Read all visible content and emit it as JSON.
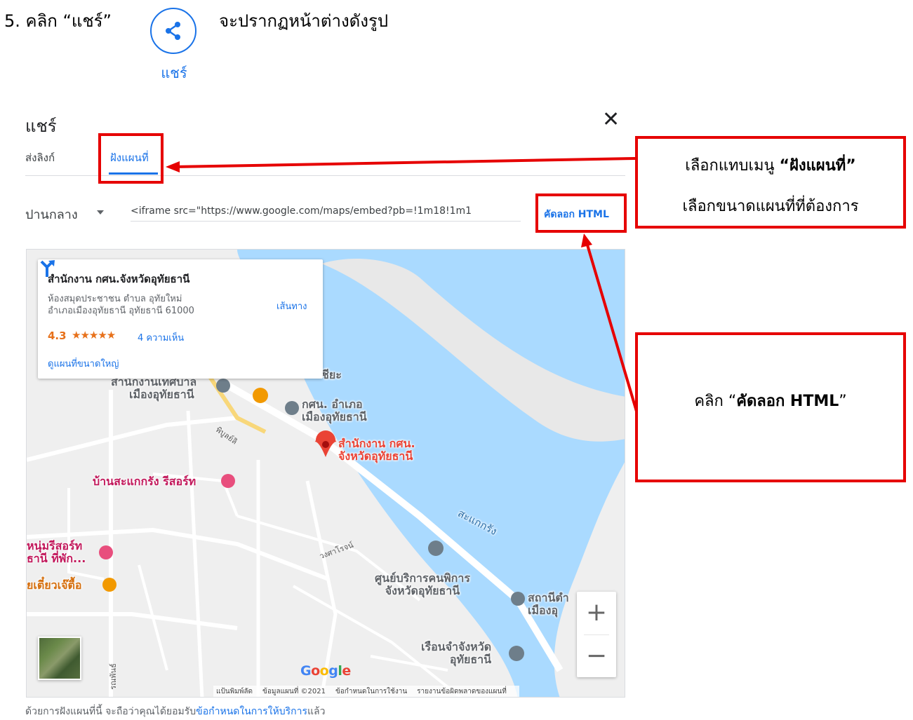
{
  "instruction": {
    "step": "5. คลิก “แชร์”",
    "after": "จะปรากฏหน้าต่างดังรูป",
    "share_button_label": "แชร์"
  },
  "dialog": {
    "title": "แชร์",
    "close_glyph": "✕",
    "tabs": [
      "ส่งลิงก์",
      "ฝังแผนที่"
    ],
    "size_select": "ปานกลาง",
    "iframe_code": "<iframe src=\"https://www.google.com/maps/embed?pb=!1m18!1m1",
    "copy_button": "คัดลอก HTML",
    "terms_prefix": "ด้วยการฝังแผนที่นี้ จะถือว่าคุณได้ยอมรับ",
    "terms_link": "ข้อกำหนดในการให้บริการ",
    "terms_suffix": "แล้ว"
  },
  "map": {
    "info_card": {
      "title": "สำนักงาน กศน.จังหวัดอุทัยธานี",
      "address_line1": "ห้องสมุดประชาชน ตำบล อุทัยใหม่",
      "address_line2": "อำเภอเมืองอุทัยธานี อุทัยธานี 61000",
      "rating": "4.3",
      "stars": "★★★★★",
      "reviews": "4 ความเห็น",
      "view_larger": "ดูแผนที่ขนาดใหญ่",
      "directions": "เส้นทาง"
    },
    "pois": {
      "municipality": "สำนักงานเทศบาล เมืองอุทัยธานี",
      "municipality_l1": "สำนักงานเทศบาล",
      "municipality_l2": "เมืองอุทัยธานี",
      "kor_sor_nor_l1": "กศน. อำเภอ",
      "kor_sor_nor_l2": "เมืองอุทัยธานี",
      "office_l1": "สำนักงาน กศน.",
      "office_l2": "จังหวัดอุทัยธานี",
      "sakae_krang_resort": "บ้านสะแกกรัง รีสอร์ท",
      "resort_2_l1": "หนุ่มรีสอร์ท",
      "resort_2_l2": "ธานี  ที่พัก...",
      "noodle": "ยเตี๋ยวเจ๊ตื้อ",
      "service_center_l1": "ศูนย์บริการคนพิการ",
      "service_center_l2": "จังหวัดอุทัยธานี",
      "station_l1": "สถานีตำ",
      "station_l2": "เมืองอุ",
      "prison_l1": "เรือนจำจังหวัด",
      "prison_l2": "อุทัยธานี",
      "river": "สะแกกรัง",
      "partial_top": "ชียะ",
      "road_1": "พิบูลย์ลิ",
      "road_2": "วงศาโรจน์",
      "road_3": "รณพันธ์"
    },
    "zoom_in": "+",
    "zoom_out": "−",
    "google_logo": [
      "G",
      "o",
      "o",
      "g",
      "l",
      "e"
    ],
    "google_colors": [
      "#4285f4",
      "#ea4335",
      "#fbbc05",
      "#4285f4",
      "#34a853",
      "#ea4335"
    ],
    "attribution": [
      "แป้นพิมพ์ลัด",
      "ข้อมูลแผนที่ ©2021",
      "ข้อกำหนดในการใช้งาน",
      "รายงานข้อผิดพลาดของแผนที่"
    ]
  },
  "annotations": {
    "box1_line1_prefix": "เลือกแทบเมนู ",
    "box1_line1_bold": "“ฝังแผนที่”",
    "box1_line2": "เลือกขนาดแผนที่ที่ต้องการ",
    "box2_prefix": "คลิก “",
    "box2_bold": "คัดลอก HTML",
    "box2_suffix": "”"
  },
  "colors": {
    "accent": "#1a73e8",
    "annotation_red": "#e60000",
    "water": "#aadaff",
    "rating": "#e7711b"
  }
}
